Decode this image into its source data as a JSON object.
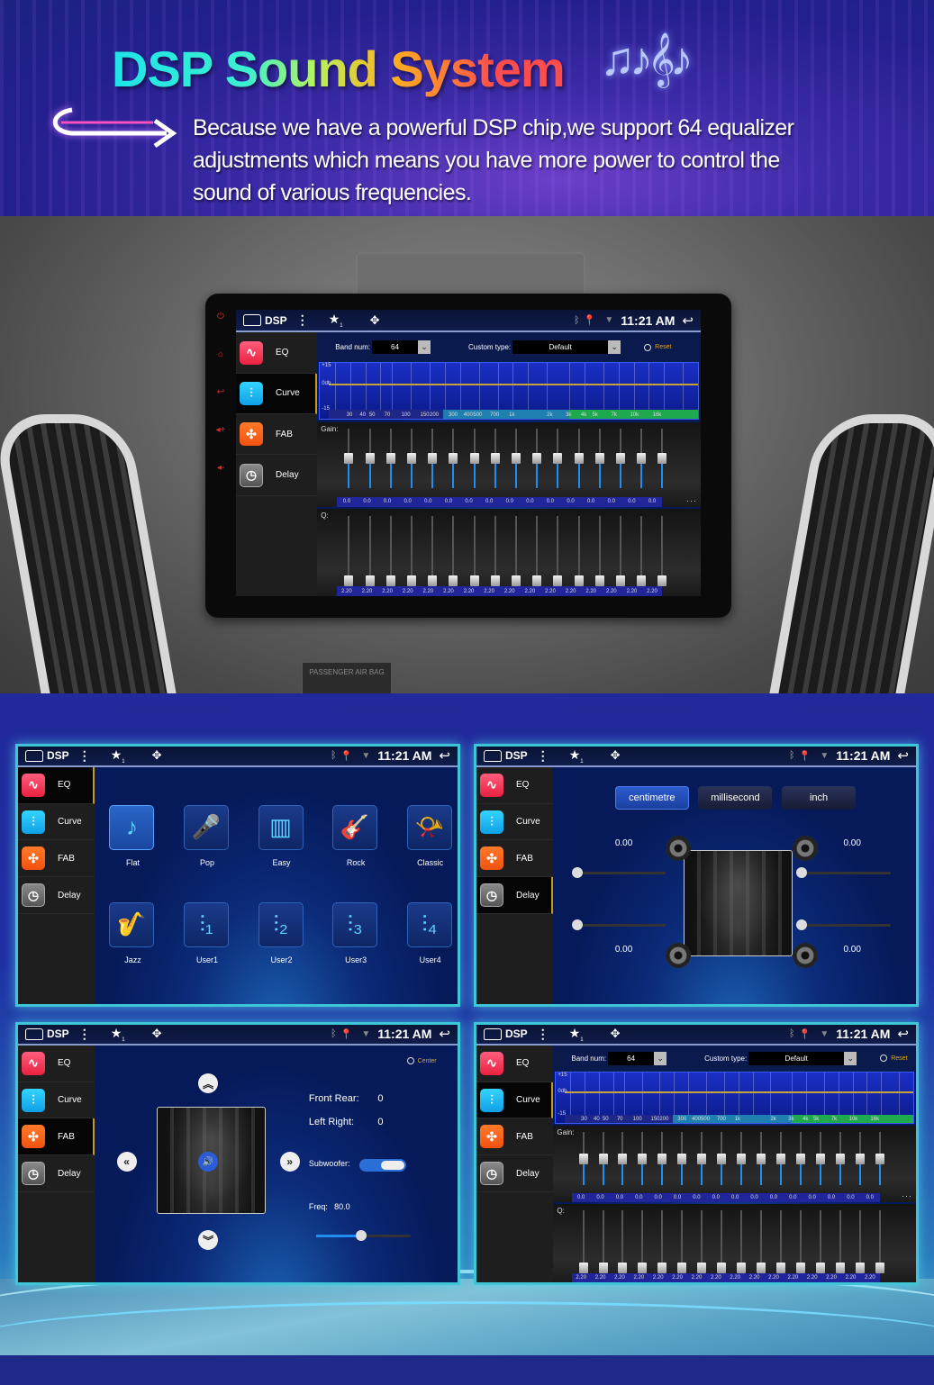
{
  "hero": {
    "title_parts": [
      "DSP ",
      "Sound ",
      "System"
    ],
    "title": "DSP Sound System",
    "music_notes_icon": "♫♪𝄞♪",
    "description": "Because we have a powerful DSP chip,we support 64 equalizer adjustments which means you have more power to control the sound of various frequencies."
  },
  "dashboard": {
    "airbag_label": "PASSENGER AIR BAG"
  },
  "status_bar": {
    "app": "DSP",
    "menu_icon": "⋮",
    "star_icon": "★",
    "star_badge": "1",
    "drag_icon": "✥",
    "bluetooth_icon": "ᛒ",
    "location_icon": "⬤",
    "wifi_icon": "▼",
    "time": "11:21 AM",
    "back_icon": "↩"
  },
  "nav": {
    "items": [
      {
        "label": "EQ",
        "icon": "∿"
      },
      {
        "label": "Curve",
        "icon": "⫶"
      },
      {
        "label": "FAB",
        "icon": "✣"
      },
      {
        "label": "Delay",
        "icon": "◷"
      }
    ]
  },
  "eq_presets": {
    "items": [
      {
        "label": "Flat",
        "icon": "♪",
        "active": true
      },
      {
        "label": "Pop",
        "icon": "🎤"
      },
      {
        "label": "Easy",
        "icon": "▥"
      },
      {
        "label": "Rock",
        "icon": "🎸"
      },
      {
        "label": "Classic",
        "icon": "📯"
      },
      {
        "label": "Jazz",
        "icon": "🎷"
      },
      {
        "label": "User1",
        "icon": "⫶₁"
      },
      {
        "label": "User2",
        "icon": "⫶₂"
      },
      {
        "label": "User3",
        "icon": "⫶₃"
      },
      {
        "label": "User4",
        "icon": "⫶₄"
      }
    ]
  },
  "delay": {
    "units": [
      "centimetre",
      "millisecond",
      "inch"
    ],
    "selected_unit": "centimetre",
    "front_left": "0.00",
    "front_right": "0.00",
    "rear_left": "0.00",
    "rear_right": "0.00",
    "slider_values": [
      0,
      0,
      0,
      0
    ]
  },
  "fab": {
    "center_label": "Center",
    "front_rear_label": "Front Rear:",
    "front_rear_value": "0",
    "left_right_label": "Left Right:",
    "left_right_value": "0",
    "subwoofer_label": "Subwoofer:",
    "subwoofer_on": true,
    "freq_label": "Freq:",
    "freq_value": "80.0",
    "freq_slider_fraction": 0.48,
    "up_icon": "︽",
    "down_icon": "︾",
    "left_icon": "«",
    "right_icon": "»",
    "speaker_icon": "🔊"
  },
  "curve": {
    "band_num_label": "Band num:",
    "band_num": "64",
    "custom_type_label": "Custom type:",
    "custom_type": "Default",
    "reset_label": "Reset",
    "y_labels": [
      "+15",
      "0db",
      "-15"
    ],
    "x_labels": [
      "30",
      "40",
      "50",
      "70",
      "100",
      "150",
      "200",
      "300",
      "400",
      "500",
      "700",
      "1k",
      "2k",
      "3k",
      "4k",
      "5k",
      "7k",
      "10k",
      "16k"
    ],
    "gain_label": "Gain:",
    "q_label": "Q:",
    "gain_values": [
      "0.0",
      "0.0",
      "0.0",
      "0.0",
      "0.0",
      "0.0",
      "0.0",
      "0.0",
      "0.0",
      "0.0",
      "0.0",
      "0.0",
      "0.0",
      "0.0",
      "0.0",
      "0.0"
    ],
    "q_values": [
      "2.20",
      "2.20",
      "2.20",
      "2.20",
      "2.20",
      "2.20",
      "2.20",
      "2.20",
      "2.20",
      "2.20",
      "2.20",
      "2.20",
      "2.20",
      "2.20",
      "2.20",
      "2.20"
    ],
    "more_label": "···"
  }
}
